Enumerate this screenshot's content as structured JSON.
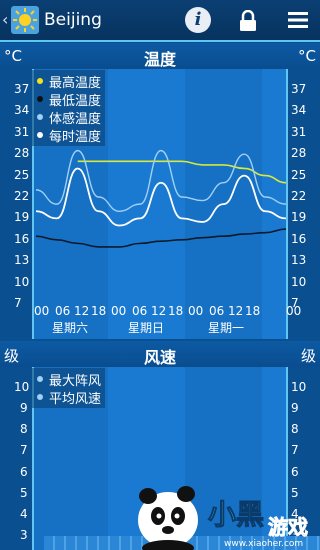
{
  "header": {
    "city": "Beijing",
    "back_icon": "chevron-left-icon",
    "info_label": "i"
  },
  "temperature": {
    "title": "温度",
    "unit_left": "°C",
    "unit_right": "°C",
    "ticks": [
      "37",
      "34",
      "31",
      "28",
      "25",
      "22",
      "19",
      "16",
      "13",
      "10",
      "7"
    ],
    "legend": [
      {
        "label": "最高温度",
        "color": "#f3e31a"
      },
      {
        "label": "最低温度",
        "color": "#101010"
      },
      {
        "label": "体感温度",
        "color": "#9fd0f5"
      },
      {
        "label": "每时温度",
        "color": "#ffffff"
      }
    ],
    "hour_labels": [
      "00",
      "06",
      "12",
      "18",
      "00",
      "06",
      "12",
      "18",
      "00",
      "06",
      "12",
      "18",
      "00"
    ],
    "days": [
      "星期六",
      "星期日",
      "星期一"
    ]
  },
  "wind": {
    "title": "风速",
    "unit_left": "级",
    "unit_right": "级",
    "ticks": [
      "10",
      "9",
      "8",
      "7",
      "6",
      "5",
      "4",
      "3"
    ],
    "legend": [
      {
        "label": "最大阵风",
        "color": "#9fd0f5"
      },
      {
        "label": "平均风速",
        "color": "#9fd0f5"
      }
    ]
  },
  "watermark": {
    "site": "www.xiaoher.com"
  },
  "chart_data": [
    {
      "type": "line",
      "title": "温度",
      "ylabel": "°C",
      "ylim": [
        4,
        40
      ],
      "x": [
        0,
        6,
        12,
        18,
        24,
        30,
        36,
        42,
        48,
        54,
        60,
        66,
        72
      ],
      "series": [
        {
          "name": "最高温度",
          "values": [
            null,
            null,
            27,
            27,
            27,
            27,
            27,
            27,
            26.5,
            26.5,
            26,
            25,
            24
          ]
        },
        {
          "name": "最低温度",
          "values": [
            16.5,
            16,
            15.5,
            15,
            15,
            15.5,
            15.8,
            16,
            16.3,
            16.5,
            16.8,
            17,
            17.5
          ]
        },
        {
          "name": "体感温度",
          "values": [
            23,
            21,
            28.5,
            22,
            20,
            21,
            28.5,
            22,
            21.5,
            24,
            28,
            22,
            21
          ]
        },
        {
          "name": "每时温度",
          "values": [
            20,
            19,
            26,
            20,
            18,
            19,
            24,
            19,
            18.5,
            21,
            25,
            20,
            19
          ]
        }
      ]
    },
    {
      "type": "bar",
      "title": "风速",
      "ylabel": "级",
      "ylim": [
        3,
        10.5
      ],
      "series": [
        {
          "name": "最大阵风",
          "values": []
        },
        {
          "name": "平均风速",
          "values": []
        }
      ]
    }
  ]
}
